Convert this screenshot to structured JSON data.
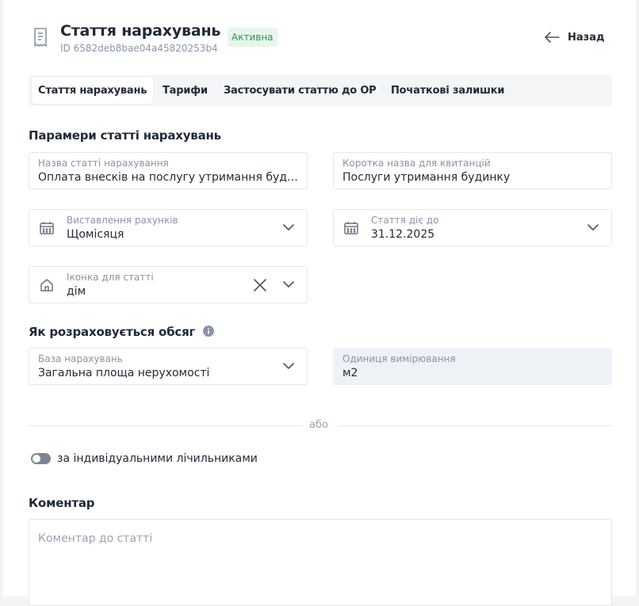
{
  "header": {
    "title": "Стаття нарахувань",
    "id_text": "ID 6582deb8bae04a45820253b4",
    "status_badge": "Активна",
    "back_label": "Назад"
  },
  "tabs": [
    {
      "label": "Стаття нарахувань",
      "active": true
    },
    {
      "label": "Тарифи",
      "active": false
    },
    {
      "label": "Застосувати статтю до ОР",
      "active": false
    },
    {
      "label": "Початкові залишки",
      "active": false
    }
  ],
  "params": {
    "section_title": "Парамери статті нарахувань",
    "name_field": {
      "label": "Назва статті нарахування",
      "value": "Оплата внесків на послугу утримання будинку"
    },
    "short_name_field": {
      "label": "Коротка назва для квитанцій",
      "value": "Послуги утримання будинку"
    },
    "billing_field": {
      "label": "Виставлення рахунків",
      "value": "Щомісяця"
    },
    "valid_until_field": {
      "label": "Стаття діє до",
      "value": "31.12.2025"
    },
    "icon_field": {
      "label": "Іконка для статті",
      "value": "дім"
    }
  },
  "volume": {
    "section_title": "Як розраховується обсяг",
    "base_field": {
      "label": "База нарахувань",
      "value": "Загальна площа нерухомості"
    },
    "unit_field": {
      "label": "Одиниця вимірювання",
      "value": "м2"
    },
    "or_text": "або",
    "meter_toggle_label": "за індивідуальними лічильниками",
    "meter_toggle_on": false
  },
  "comment": {
    "section_title": "Коментар",
    "placeholder": "Коментар до статті",
    "value": ""
  },
  "colors": {
    "badge_bg": "#e7f6ec",
    "badge_text": "#1e9e4e",
    "muted": "#8a94a6"
  }
}
